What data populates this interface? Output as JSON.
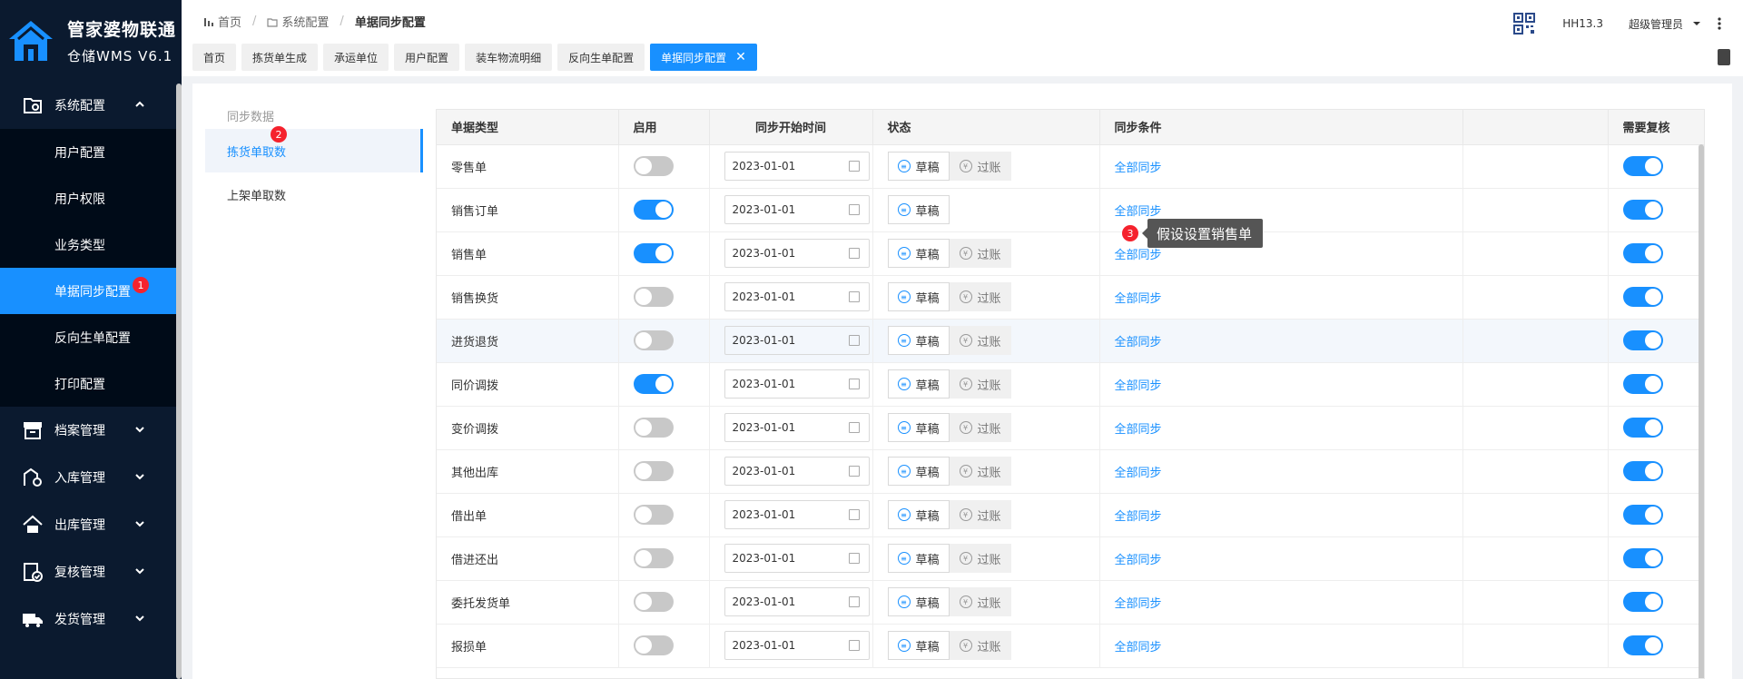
{
  "brand": {
    "title": "管家婆物联通",
    "subtitle": "仓储WMS V6.1"
  },
  "sidebar": {
    "system_config": "系统配置",
    "sub_items": [
      "用户配置",
      "用户权限",
      "业务类型",
      "单据同步配置",
      "反向生单配置",
      "打印配置"
    ],
    "active_index": 3,
    "active_badge": "1",
    "groups": [
      {
        "label": "档案管理",
        "icon": "archive-icon"
      },
      {
        "label": "入库管理",
        "icon": "inbound-icon"
      },
      {
        "label": "出库管理",
        "icon": "outbound-icon"
      },
      {
        "label": "复核管理",
        "icon": "review-icon"
      },
      {
        "label": "发货管理",
        "icon": "delivery-icon"
      }
    ]
  },
  "breadcrumb": {
    "home": "首页",
    "section": "系统配置",
    "current": "单据同步配置"
  },
  "header": {
    "version": "HH13.3",
    "user": "超级管理员"
  },
  "tabs": [
    {
      "label": "首页",
      "active": false
    },
    {
      "label": "拣货单生成",
      "active": false
    },
    {
      "label": "承运单位",
      "active": false
    },
    {
      "label": "用户配置",
      "active": false
    },
    {
      "label": "装车物流明细",
      "active": false
    },
    {
      "label": "反向生单配置",
      "active": false
    },
    {
      "label": "单据同步配置",
      "active": true
    }
  ],
  "left_panel": {
    "title": "同步数据",
    "items": [
      "拣货单取数",
      "上架单取数"
    ],
    "badge": "2"
  },
  "table": {
    "headers": {
      "type": "单据类型",
      "enable": "启用",
      "start": "同步开始时间",
      "status": "状态",
      "cond": "同步条件",
      "review": "需要复核"
    },
    "draft_label": "草稿",
    "post_label": "过账",
    "rows": [
      {
        "type": "零售单",
        "enabled": false,
        "date": "2023-01-01",
        "post": true,
        "cond": "全部同步",
        "review": true
      },
      {
        "type": "销售订单",
        "enabled": true,
        "date": "2023-01-01",
        "post": false,
        "cond": "全部同步",
        "review": true
      },
      {
        "type": "销售单",
        "enabled": true,
        "date": "2023-01-01",
        "post": true,
        "cond": "全部同步",
        "review": true
      },
      {
        "type": "销售换货",
        "enabled": false,
        "date": "2023-01-01",
        "post": true,
        "cond": "全部同步",
        "review": true
      },
      {
        "type": "进货退货",
        "enabled": false,
        "date": "2023-01-01",
        "post": true,
        "cond": "全部同步",
        "review": true
      },
      {
        "type": "同价调拨",
        "enabled": true,
        "date": "2023-01-01",
        "post": true,
        "cond": "全部同步",
        "review": true
      },
      {
        "type": "变价调拨",
        "enabled": false,
        "date": "2023-01-01",
        "post": true,
        "cond": "全部同步",
        "review": true
      },
      {
        "type": "其他出库",
        "enabled": false,
        "date": "2023-01-01",
        "post": true,
        "cond": "全部同步",
        "review": true
      },
      {
        "type": "借出单",
        "enabled": false,
        "date": "2023-01-01",
        "post": true,
        "cond": "全部同步",
        "review": true
      },
      {
        "type": "借进还出",
        "enabled": false,
        "date": "2023-01-01",
        "post": true,
        "cond": "全部同步",
        "review": true
      },
      {
        "type": "委托发货单",
        "enabled": false,
        "date": "2023-01-01",
        "post": true,
        "cond": "全部同步",
        "review": true
      },
      {
        "type": "报损单",
        "enabled": false,
        "date": "2023-01-01",
        "post": true,
        "cond": "全部同步",
        "review": true
      }
    ]
  },
  "tooltip": {
    "badge": "3",
    "text": "假设设置销售单"
  },
  "colors": {
    "accent": "#1890ff",
    "sidebar": "#0b1a2f",
    "badge": "#f5222d"
  }
}
